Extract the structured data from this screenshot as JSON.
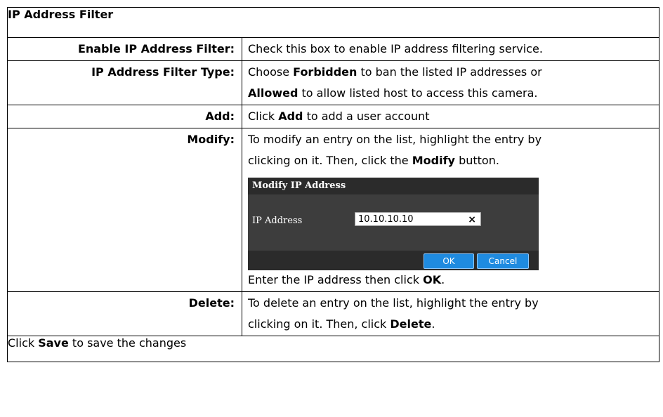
{
  "header": {
    "title": "IP Address Filter"
  },
  "rows": {
    "enable": {
      "label": "Enable IP Address Filter:",
      "text": "Check this box to enable IP address filtering service."
    },
    "filter_type": {
      "label": "IP Address Filter Type:",
      "l1_a": "Choose ",
      "l1_b": "Forbidden",
      "l1_c": " to ban the listed IP addresses or",
      "l2_a": "Allowed",
      "l2_b": " to allow listed host to access this camera."
    },
    "add": {
      "label": "Add:",
      "a": "Click ",
      "b": "Add",
      "c": " to add a user account"
    },
    "modify": {
      "label": "Modify:",
      "l1": "To modify an entry on the list, highlight the entry by",
      "l2_a": "clicking on it. Then, click the ",
      "l2_b": "Modify",
      "l2_c": " button.",
      "l3_a": "Enter the IP address then click ",
      "l3_b": "OK",
      "l3_c": "."
    },
    "delete": {
      "label": "Delete:",
      "l1": "To delete an entry on the list, highlight the entry by",
      "l2_a": "clicking on it. Then, click ",
      "l2_b": "Delete",
      "l2_c": "."
    }
  },
  "dialog": {
    "title": "Modify IP Address",
    "field_label": "IP Address",
    "field_value": "10.10.10.10",
    "clear_icon": "×",
    "ok_label": "OK",
    "cancel_label": "Cancel",
    "colors": {
      "body": "#3d3d3d",
      "bar": "#2b2b2b",
      "button": "#1f8be0"
    }
  },
  "footer": {
    "a": "Click ",
    "b": "Save",
    "c": " to save the changes"
  }
}
